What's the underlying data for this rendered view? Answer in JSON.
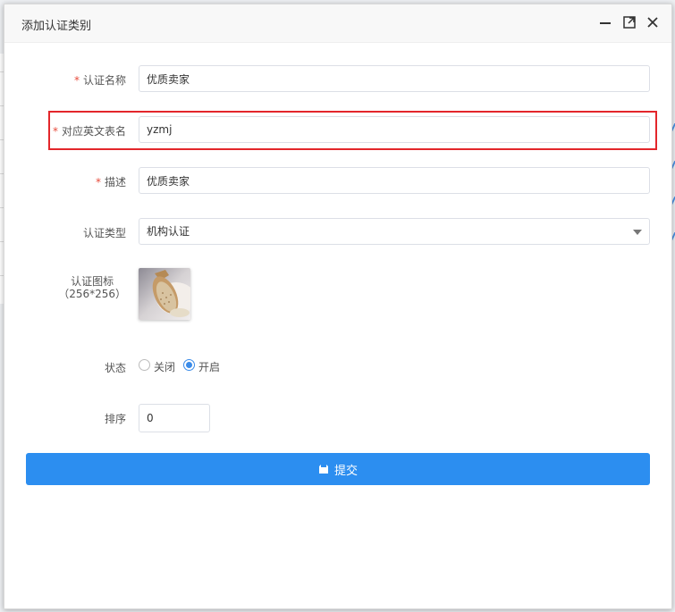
{
  "dialog": {
    "title": "添加认证类别"
  },
  "form": {
    "name": {
      "label": "认证名称",
      "required": true,
      "value": "优质卖家"
    },
    "table_name": {
      "label": "对应英文表名",
      "required": true,
      "value": "yzmj"
    },
    "description": {
      "label": "描述",
      "required": true,
      "value": "优质卖家"
    },
    "type": {
      "label": "认证类型",
      "value": "机构认证"
    },
    "icon": {
      "label": "认证图标",
      "hint": "（256*256）"
    },
    "status": {
      "label": "状态",
      "options": [
        {
          "label": "关闭",
          "checked": false
        },
        {
          "label": "开启",
          "checked": true
        }
      ]
    },
    "sort": {
      "label": "排序",
      "value": "0"
    }
  },
  "submit": {
    "label": "提交"
  },
  "colors": {
    "primary": "#2c8ef0",
    "required": "#e74c3c",
    "highlight": "#e3262b"
  }
}
